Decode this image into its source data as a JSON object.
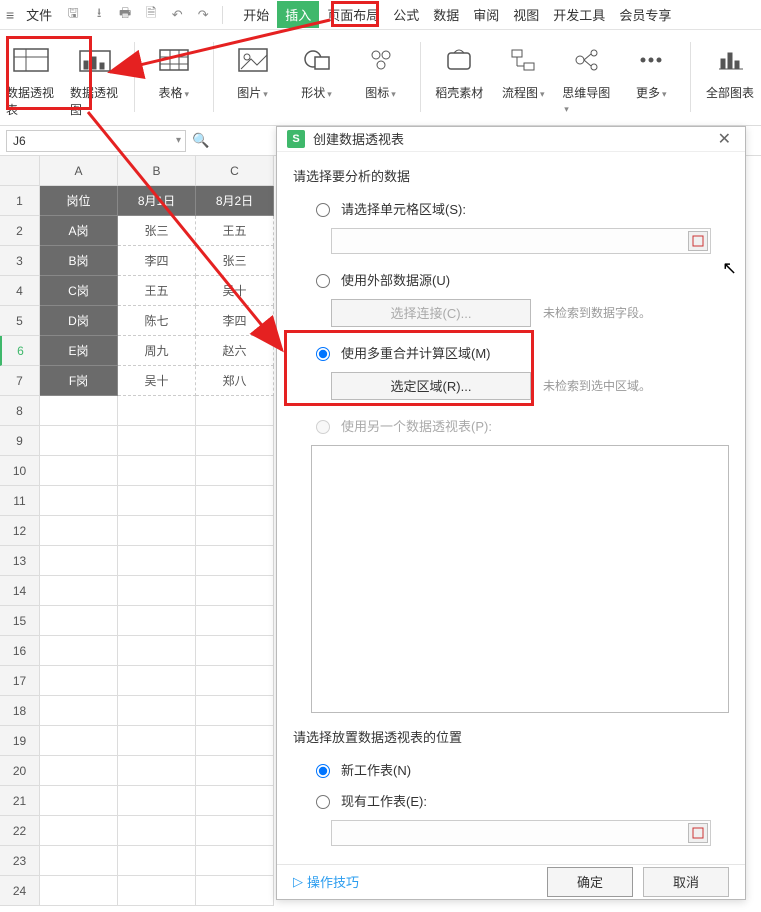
{
  "menubar": {
    "file": "文件",
    "tabs": [
      "开始",
      "插入",
      "页面布局",
      "公式",
      "数据",
      "审阅",
      "视图",
      "开发工具",
      "会员专享"
    ]
  },
  "ribbon": {
    "pivot_table": "数据透视表",
    "pivot_chart": "数据透视图",
    "table": "表格",
    "picture": "图片",
    "shape": "形状",
    "icon": "图标",
    "dk_material": "稻壳素材",
    "flowchart": "流程图",
    "mindmap": "思维导图",
    "more": "更多",
    "all_charts": "全部图表"
  },
  "namebox": {
    "value": "J6"
  },
  "sheet": {
    "cols": [
      "A",
      "B",
      "C"
    ],
    "rows": [
      "1",
      "2",
      "3",
      "4",
      "5",
      "6",
      "7",
      "8",
      "9",
      "10",
      "11",
      "12",
      "13",
      "14",
      "15",
      "16",
      "17",
      "18",
      "19",
      "20",
      "21",
      "22",
      "23",
      "24"
    ],
    "header": {
      "c1": "岗位",
      "c2": "8月1日",
      "c3": "8月2日"
    },
    "row1": {
      "c1": "A岗",
      "c2": "张三",
      "c3": "王五"
    },
    "row2": {
      "c1": "B岗",
      "c2": "李四",
      "c3": "张三"
    },
    "row3": {
      "c1": "C岗",
      "c2": "王五",
      "c3": "吴十"
    },
    "row4": {
      "c1": "D岗",
      "c2": "陈七",
      "c3": "李四"
    },
    "row5": {
      "c1": "E岗",
      "c2": "周九",
      "c3": "赵六"
    },
    "row6": {
      "c1": "F岗",
      "c2": "吴十",
      "c3": "郑八"
    }
  },
  "dialog": {
    "title": "创建数据透视表",
    "section1": "请选择要分析的数据",
    "opt_range": "请选择单元格区域(S):",
    "opt_external": "使用外部数据源(U)",
    "btn_choose_conn": "选择连接(C)...",
    "note_no_fields": "未检索到数据字段。",
    "opt_multi": "使用多重合并计算区域(M)",
    "btn_select_area": "选定区域(R)...",
    "note_no_area": "未检索到选中区域。",
    "opt_another_pivot": "使用另一个数据透视表(P):",
    "section2": "请选择放置数据透视表的位置",
    "opt_new_sheet": "新工作表(N)",
    "opt_existing_sheet": "现有工作表(E):",
    "tips": "操作技巧",
    "ok": "确定",
    "cancel": "取消"
  }
}
